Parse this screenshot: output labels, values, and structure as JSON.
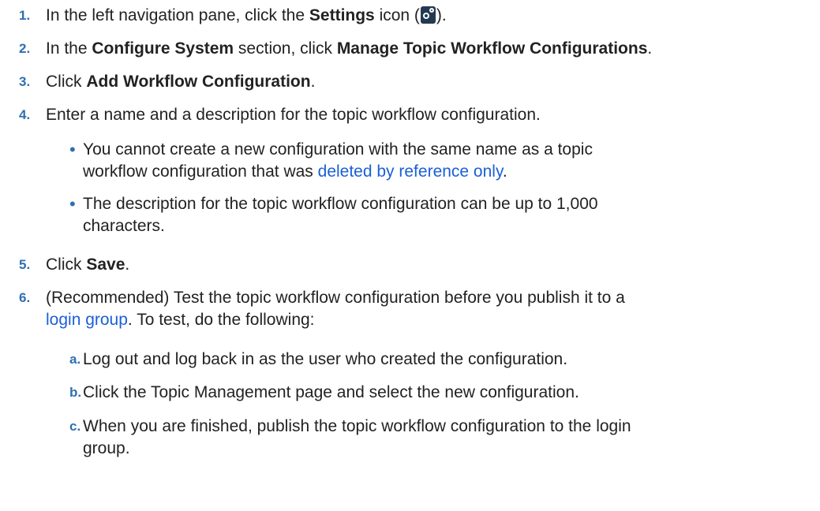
{
  "steps": [
    {
      "number": "1.",
      "t1": "In the left navigation pane, click the ",
      "b1": "Settings",
      "t2": " icon (",
      "icon": "settings-gear-icon",
      "t3": ")."
    },
    {
      "number": "2.",
      "t1": "In the ",
      "b1": "Configure System",
      "t2": " section, click ",
      "b2": "Manage Topic Workflow Configurations",
      "t3": "."
    },
    {
      "number": "3.",
      "t1": "Click ",
      "b1": "Add Workflow Configuration",
      "t2": "."
    },
    {
      "number": "4.",
      "t1": "Enter a name and a description for the topic workflow configuration.",
      "bullets": [
        {
          "marker": "•",
          "line1": "You cannot create a new configuration with the same name as a topic",
          "line2_pre": "workflow configuration that was ",
          "link": "deleted by reference only",
          "line2_post": "."
        },
        {
          "marker": "•",
          "line1": "The description for the topic workflow configuration can be up to 1,000",
          "line2": "characters."
        }
      ]
    },
    {
      "number": "5.",
      "t1": "Click ",
      "b1": "Save",
      "t2": "."
    },
    {
      "number": "6.",
      "line1": "(Recommended) Test the topic workflow configuration before you publish it to a",
      "link": "login group",
      "line2_post": ". To test, do the following:",
      "substeps": [
        {
          "letter": "a.",
          "text": "Log out and log back in as the user who created the configuration."
        },
        {
          "letter": "b.",
          "text": "Click the Topic Management page and select the new configuration."
        },
        {
          "letter": "c.",
          "line1": "When you are finished, publish the topic workflow configuration to the login",
          "line2": "group."
        }
      ]
    }
  ],
  "colors": {
    "number": "#2f6fb0",
    "link": "#1a5fd8",
    "text": "#222222",
    "icon_bg": "#243a52"
  }
}
